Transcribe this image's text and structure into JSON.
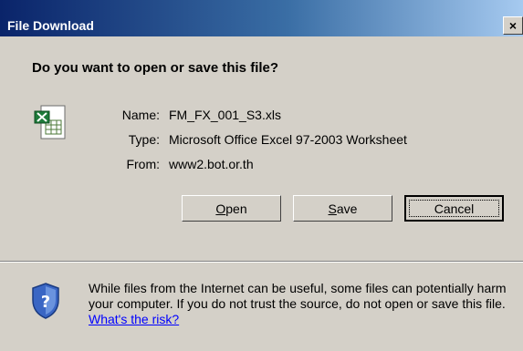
{
  "window": {
    "title": "File Download",
    "close_label": "×"
  },
  "dialog": {
    "question": "Do you want to open or save this file?",
    "fields": [
      {
        "label": "Name:",
        "value": "FM_FX_001_S3.xls"
      },
      {
        "label": "Type:",
        "value": "Microsoft Office Excel 97-2003 Worksheet"
      },
      {
        "label": "From:",
        "value": "www2.bot.or.th"
      }
    ],
    "buttons": {
      "open": {
        "label": "Open",
        "accel": "O",
        "rest": "pen"
      },
      "save": {
        "label": "Save",
        "accel": "S",
        "rest": "ave"
      },
      "cancel": {
        "label": "Cancel"
      }
    },
    "warning": {
      "text": "While files from the Internet can be useful, some files can potentially harm your computer. If you do not trust the source, do not open or save this file. ",
      "link": "What's the risk?"
    }
  },
  "colors": {
    "titlebar_start": "#0a246a",
    "titlebar_end": "#a6caf0",
    "face": "#d4d0c8",
    "link": "#0000ff"
  },
  "icons": {
    "file": "excel-file-icon",
    "security": "security-shield-icon"
  }
}
